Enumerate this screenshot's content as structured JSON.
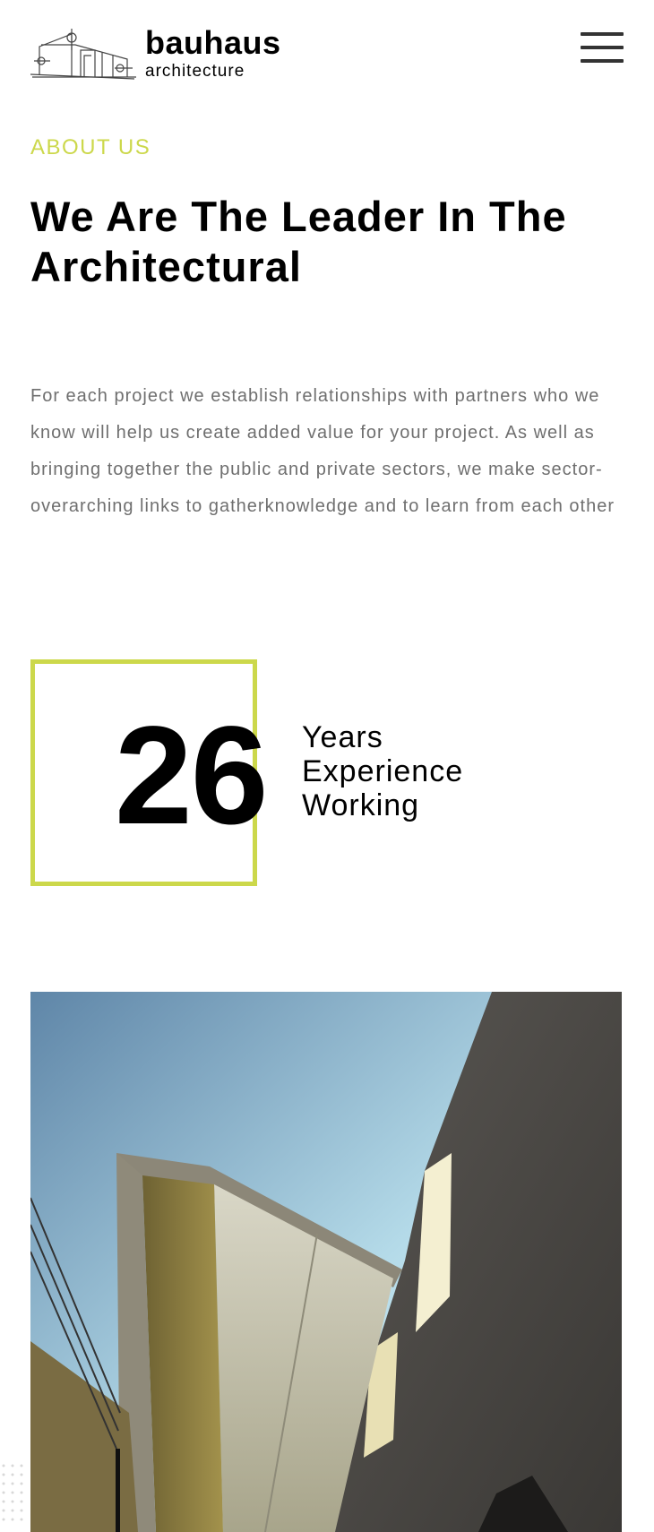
{
  "header": {
    "brand_name": "bauhaus",
    "brand_sub": "architecture",
    "menu_icon": "hamburger-menu-icon"
  },
  "about": {
    "eyebrow": "ABOUT US",
    "headline": "We Are The Leader In The Architectural",
    "body": "For each project we establish relationships with partners who we know will help us create added value for your project. As well as bringing together the public and private sectors, we make sector-overarching links to gatherknowledge and to learn from each other"
  },
  "stat": {
    "number": "26",
    "label_lines": [
      "Years",
      "Experience",
      "Working"
    ]
  },
  "colors": {
    "accent": "#ccd84b",
    "text": "#000000",
    "muted": "#6f6f6f"
  }
}
